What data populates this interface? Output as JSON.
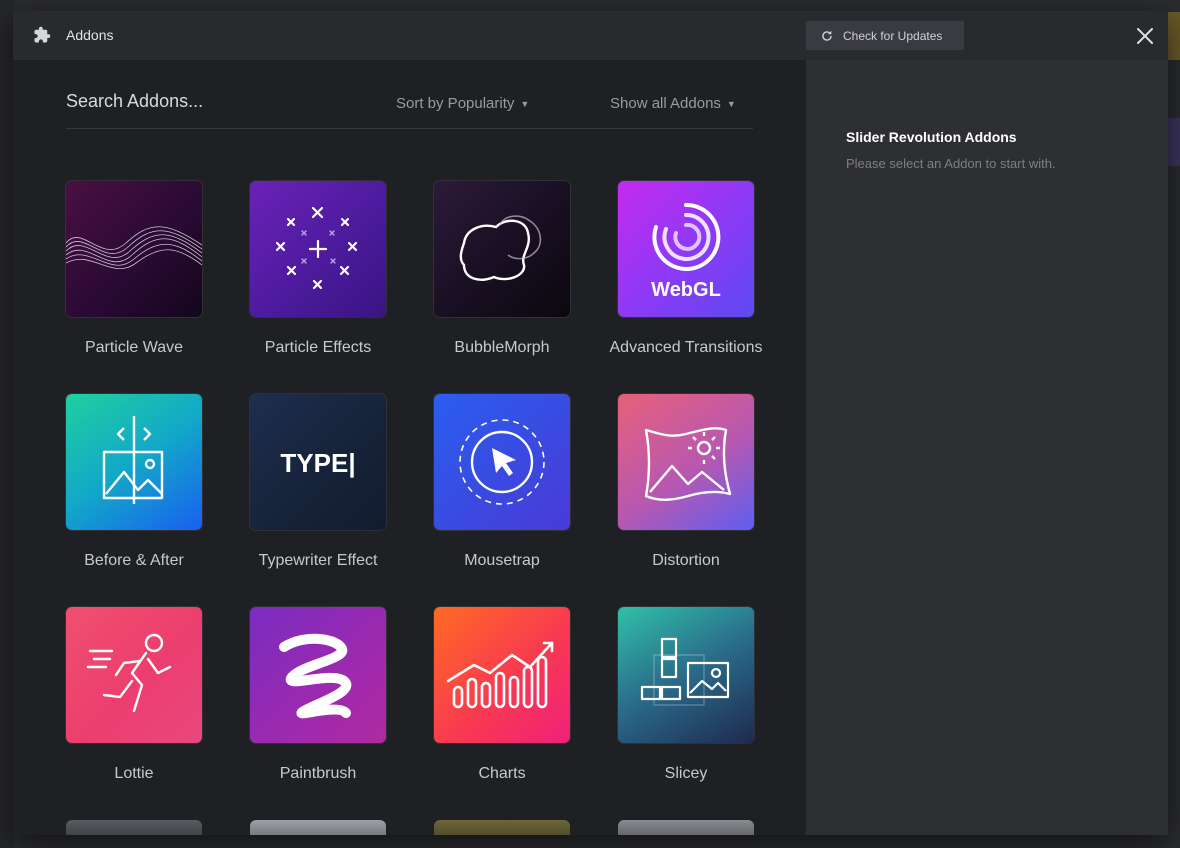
{
  "header": {
    "title": "Addons",
    "update_label": "Check for Updates"
  },
  "toolbar": {
    "search_placeholder": "Search Addons...",
    "sort_label": "Sort by Popularity",
    "filter_label": "Show all Addons"
  },
  "addons": [
    {
      "label": "Particle Wave"
    },
    {
      "label": "Particle Effects"
    },
    {
      "label": "BubbleMorph"
    },
    {
      "label": "Advanced Transitions",
      "icon_text": "WebGL"
    },
    {
      "label": "Before & After"
    },
    {
      "label": "Typewriter Effect",
      "icon_text": "TYPE|"
    },
    {
      "label": "Mousetrap"
    },
    {
      "label": "Distortion"
    },
    {
      "label": "Lottie"
    },
    {
      "label": "Paintbrush"
    },
    {
      "label": "Charts"
    },
    {
      "label": "Slicey"
    }
  ],
  "details": {
    "title": "Slider Revolution Addons",
    "subtitle": "Please select an Addon to start with."
  },
  "colors": {
    "modal_bg": "#1f2023",
    "header_bg": "#292a2e",
    "panel_bg": "#2e2f33"
  }
}
